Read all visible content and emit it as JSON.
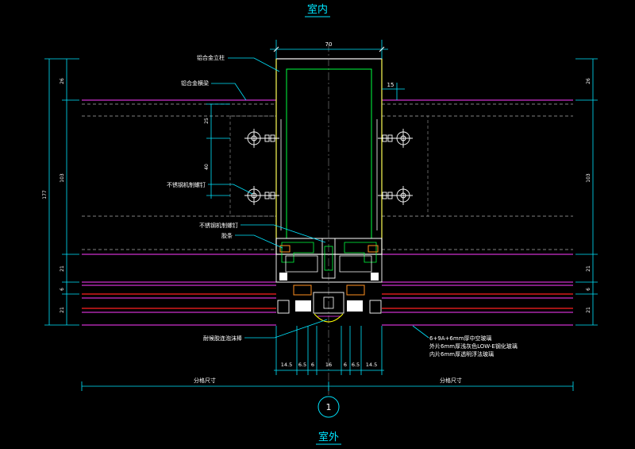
{
  "titles": {
    "top": "室内",
    "bottom": "室外",
    "detail_number": "1"
  },
  "annotations": {
    "mullion": "铝合金立柱",
    "transom": "铝合金横梁",
    "screw_upper": "不锈钢机制螺钉",
    "screw_lower": "不锈钢机制螺钉",
    "gasket": "胶条",
    "weather_rod": "耐候胶连泡沫棒",
    "glass_1": "6+9A+6mm厚中空玻璃",
    "glass_2": "外片6mm厚浅灰色LOW-E钢化玻璃",
    "glass_3": "内片6mm厚透明浮法玻璃"
  },
  "dimensions": {
    "top_width": "70",
    "right_offset": "15",
    "left_total": "177",
    "left_top": "26",
    "left_mid": "103",
    "left_21a": "21",
    "left_6": "6",
    "left_21b": "21",
    "inner_25": "25",
    "inner_40": "40",
    "right_top": "26",
    "right_mid": "103",
    "right_21a": "21",
    "right_6": "6",
    "right_21b": "21",
    "bottom": [
      "14.5",
      "6.5",
      "6",
      "16",
      "6",
      "6.5",
      "14.5"
    ],
    "grid_left": "分格尺寸",
    "grid_right": "分格尺寸"
  },
  "colors": {
    "background": "#000000",
    "cyan": "#00e5ff",
    "magenta": "#ff3cff",
    "white": "#ffffff",
    "yellow": "#ffff00",
    "green": "#00ff40",
    "red": "#ff2020",
    "orange": "#ff9020"
  }
}
